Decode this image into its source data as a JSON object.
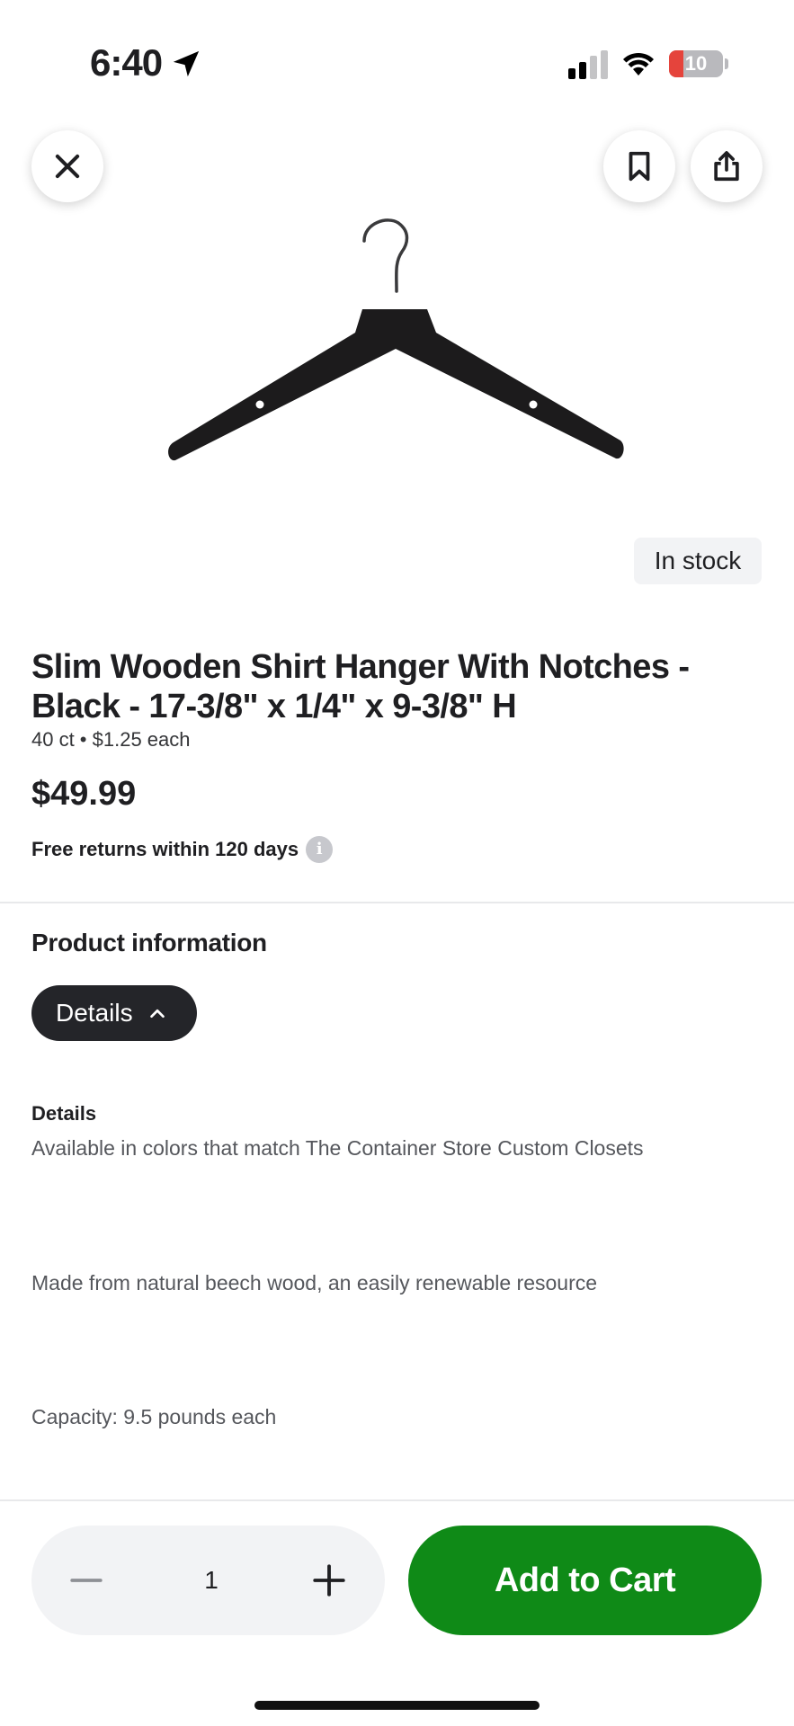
{
  "status_bar": {
    "time": "6:40",
    "battery_level": "10",
    "battery_fraction": 0.1,
    "battery_low_color": "#e5443c",
    "icons": [
      "location-arrow-icon",
      "cellular-signal-icon",
      "wifi-icon",
      "battery-icon"
    ]
  },
  "header": {
    "close_icon": "close-icon",
    "bookmark_icon": "bookmark-icon",
    "share_icon": "share-icon"
  },
  "product": {
    "stock_status": "In stock",
    "title": "Slim Wooden Shirt Hanger With Notches - Black - 17-3/8\" x 1/4\" x 9-3/8\" H",
    "unit_info": "40 ct • $1.25 each",
    "price": "$49.99",
    "returns": "Free returns within 120 days",
    "info_icon": "i"
  },
  "product_info": {
    "heading": "Product information",
    "tab_label": "Details",
    "details_label": "Details",
    "details": [
      "Available in colors that match The Container Store Custom Closets",
      "Made from natural beech wood, an easily renewable resource",
      "Capacity: 9.5 pounds each"
    ]
  },
  "cart": {
    "quantity": "1",
    "add_to_cart_label": "Add to Cart"
  },
  "colors": {
    "accent_green": "#0f8a17",
    "pill_dark": "#242529",
    "text_primary": "#1f1f22",
    "text_secondary": "#55575c"
  }
}
